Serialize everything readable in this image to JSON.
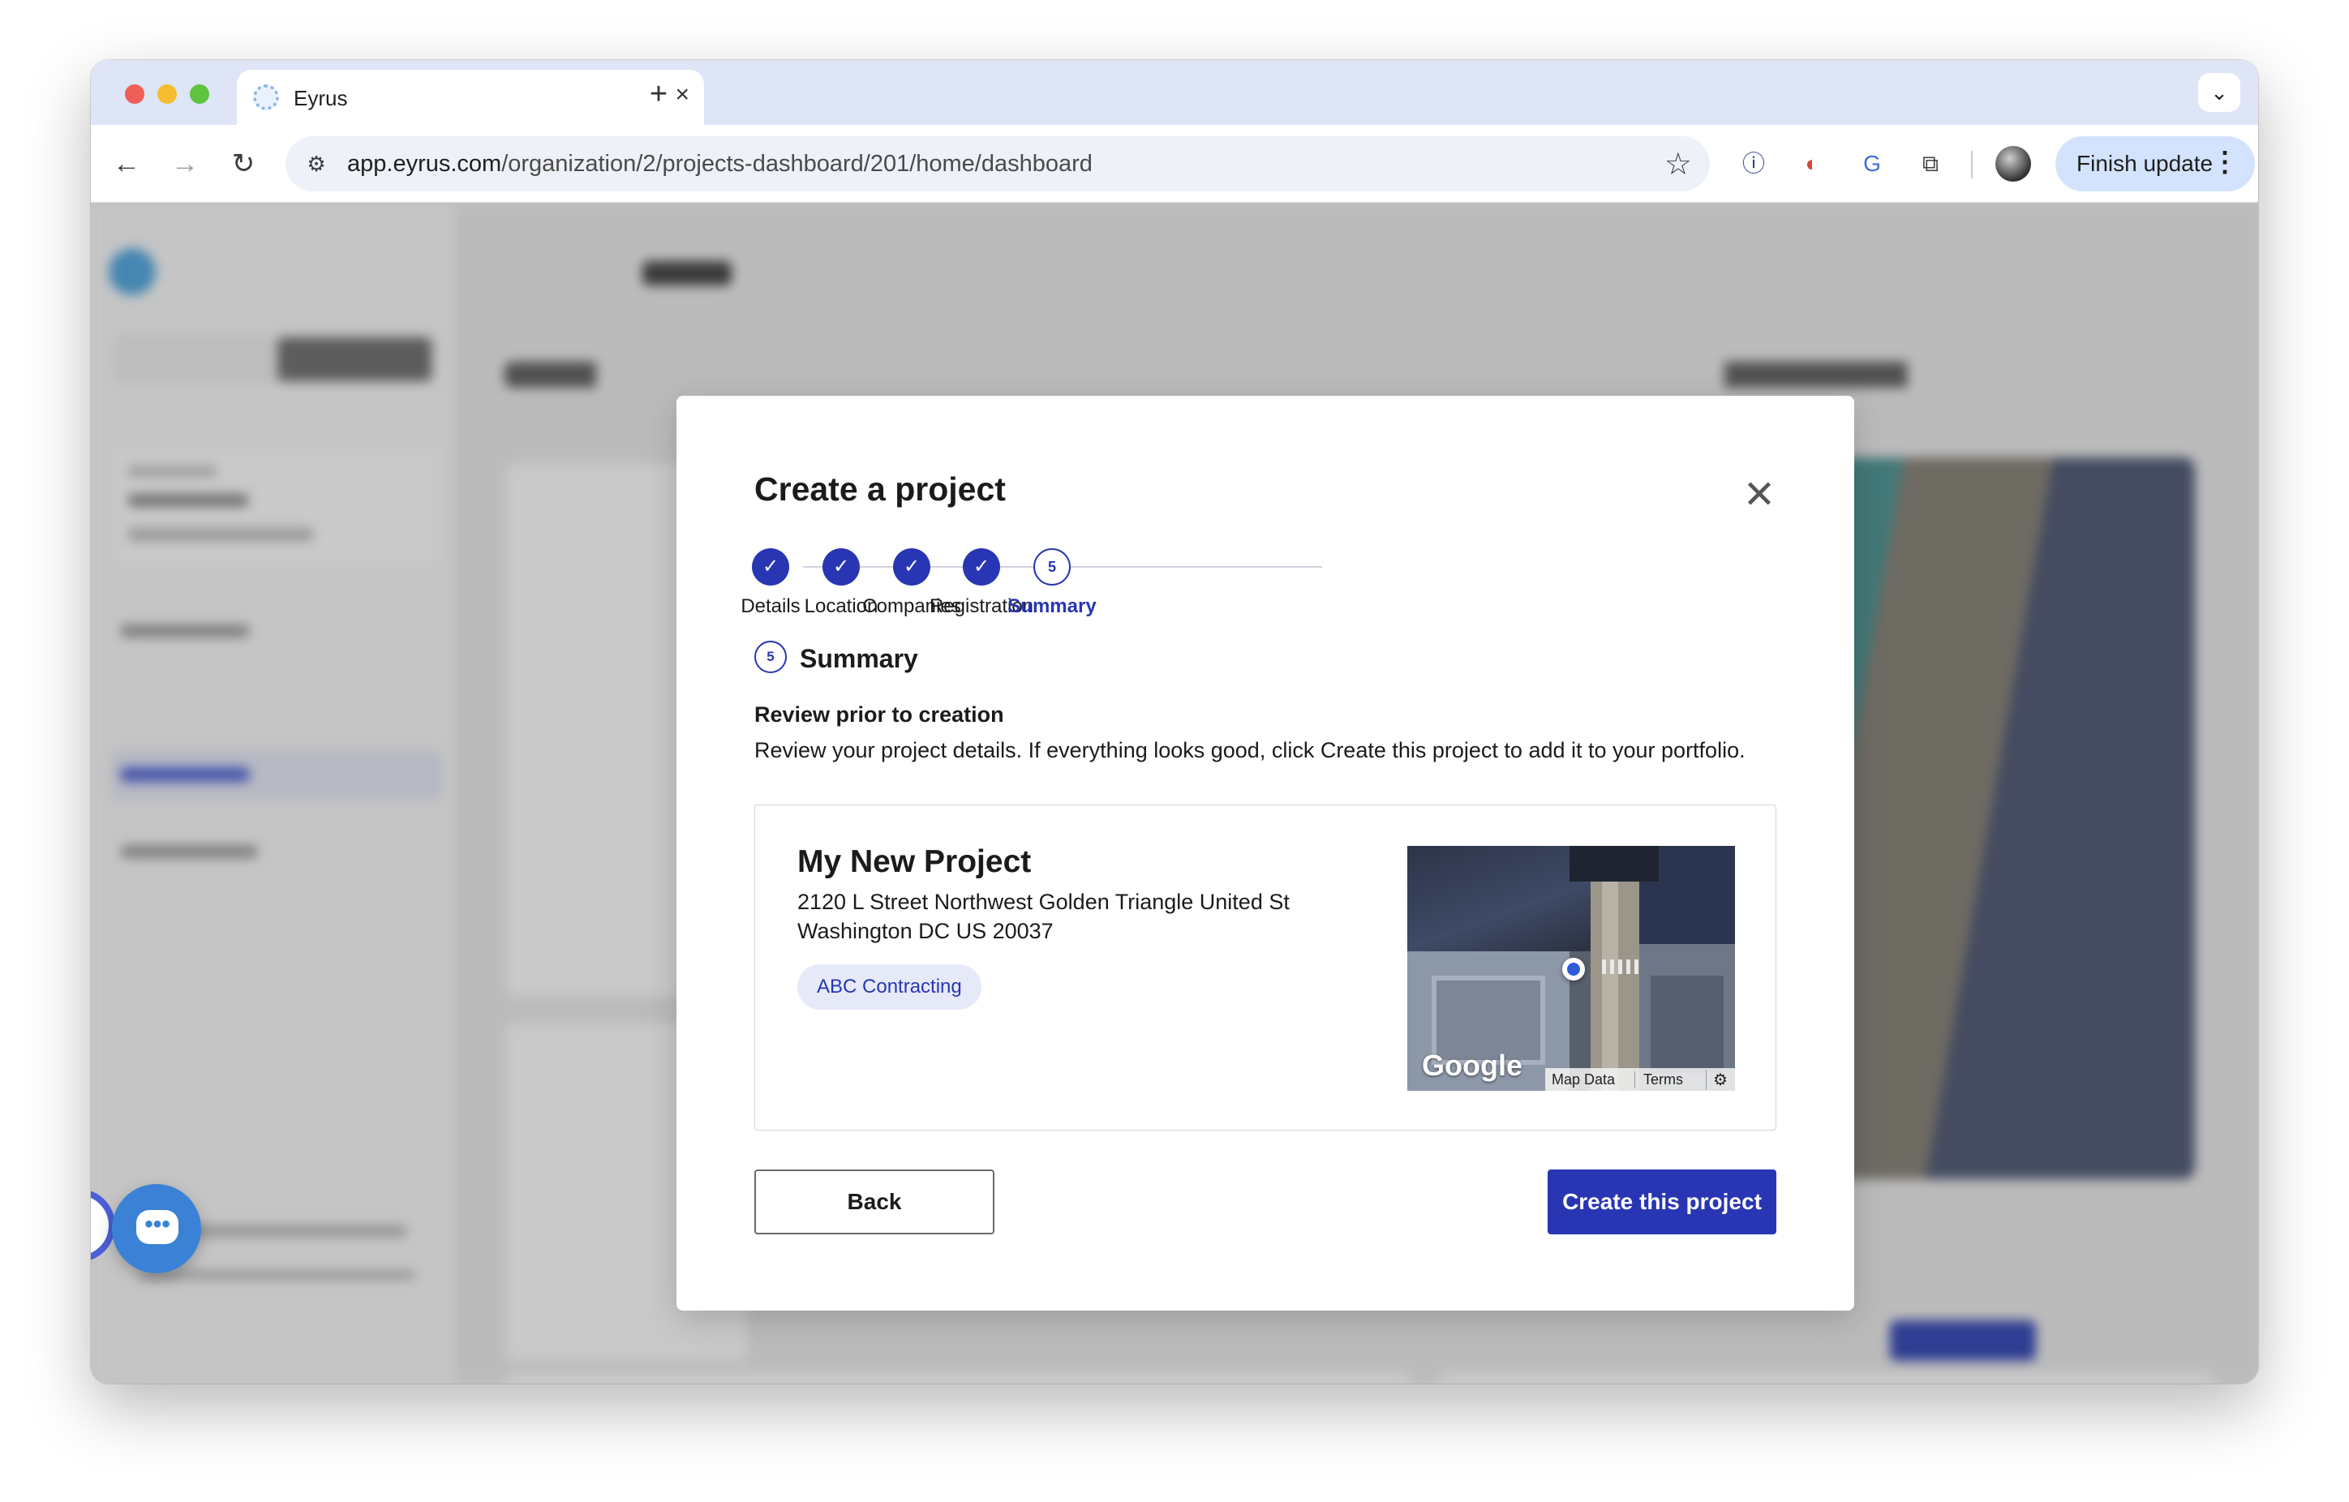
{
  "browser": {
    "tab_title": "Eyrus",
    "tab_close_icon": "×",
    "new_tab_icon": "+",
    "tab_dropdown_icon": "⌄",
    "nav_back_icon": "←",
    "nav_forward_icon": "→",
    "nav_reload_icon": "↻",
    "site_info_icon": "⚙",
    "url_host": "app.eyrus.com",
    "url_path": "/organization/2/projects-dashboard/201/home/dashboard",
    "bookmark_icon": "☆",
    "extensions": [
      "ⓘ",
      "◐",
      "G",
      "⧉"
    ],
    "finish_update_label": "Finish update",
    "menu_icon": "⋮"
  },
  "modal": {
    "title": "Create a project",
    "close_icon": "✕",
    "steps": [
      {
        "label": "Details",
        "status": "complete",
        "marker": "✓"
      },
      {
        "label": "Location",
        "status": "complete",
        "marker": "✓"
      },
      {
        "label": "Companies",
        "status": "complete",
        "marker": "✓"
      },
      {
        "label": "Registration",
        "status": "complete",
        "marker": "✓"
      },
      {
        "label": "Summary",
        "status": "active",
        "marker": "5"
      }
    ],
    "section": {
      "number": "5",
      "title": "Summary"
    },
    "review_heading": "Review prior to creation",
    "review_description": "Review your project details. If everything looks good, click Create this project to add it to your portfolio.",
    "project": {
      "name": "My New Project",
      "address_line1": "2120 L Street Northwest Golden Triangle United St",
      "address_line2": "Washington DC US 20037",
      "company": "ABC Contracting",
      "map": {
        "logo_text": "Google",
        "map_data_label": "Map Data",
        "terms_label": "Terms",
        "report_icon": "⚙"
      }
    },
    "back_label": "Back",
    "create_label": "Create this project"
  },
  "chat": {
    "icon": "•••"
  },
  "colors": {
    "primary": "#2836b3",
    "chip_bg": "#e6eaf8",
    "chrome_tab_bg": "#dde5f6"
  }
}
